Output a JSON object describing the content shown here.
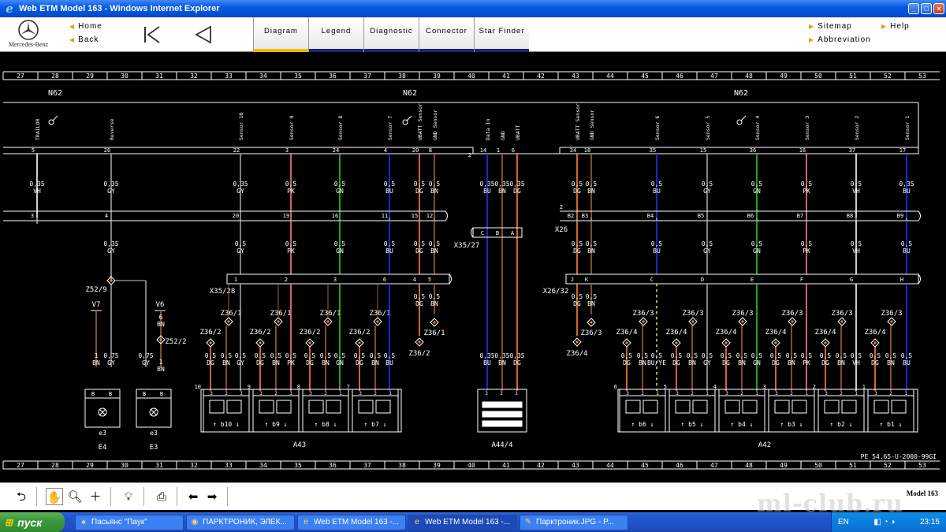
{
  "window": {
    "title": "Web ETM Model 163 - Windows Internet Explorer",
    "controls": [
      "_",
      "□",
      "×"
    ]
  },
  "header": {
    "brand": "Mercedes-Benz",
    "nav_left": [
      {
        "label": "Home"
      },
      {
        "label": "Back"
      }
    ],
    "tabs": [
      {
        "label": "Diagram",
        "active": true
      },
      {
        "label": "Legend"
      },
      {
        "label": "Diagnostic"
      },
      {
        "label": "Connector"
      },
      {
        "label": "Star Finder"
      }
    ],
    "nav_right": [
      {
        "label": "Sitemap"
      },
      {
        "label": "Help"
      },
      {
        "label": "Abbreviation"
      }
    ],
    "icons": [
      "first-page-icon",
      "previous-page-icon"
    ]
  },
  "diagram": {
    "grid_numbers": [
      "27",
      "28",
      "29",
      "30",
      "31",
      "32",
      "33",
      "34",
      "35",
      "36",
      "37",
      "38",
      "39",
      "40",
      "41",
      "42",
      "43",
      "44",
      "45",
      "46",
      "47",
      "48",
      "49",
      "50",
      "51",
      "52",
      "53"
    ],
    "module_labels": [
      "N62",
      "N62",
      "N62"
    ],
    "doc_ref": "PE 54.65-U-2000-99GI",
    "colors": {
      "GY": "#a0a0a0",
      "VH": "#ffffff",
      "PK": "#ff7a8a",
      "GN": "#2ec82e",
      "BU": "#2030ff",
      "BN": "#a06030",
      "DG": "#ff8040"
    },
    "top_pins": [
      {
        "label": "TRAILOR",
        "pin": "5",
        "wire": [
          "0,35",
          "VH"
        ],
        "col": "VH"
      },
      {
        "label": "Reverse",
        "pin": "26",
        "wire": [
          "0,35",
          "GY"
        ],
        "col": "GY"
      },
      {
        "label": "Sensor 10",
        "pin": "22",
        "wire": [
          "0,35",
          "GY"
        ],
        "col": "GY"
      },
      {
        "label": "Sensor 9",
        "pin": "3",
        "wire": [
          "0,5",
          "PK"
        ],
        "col": "PK"
      },
      {
        "label": "Sensor 8",
        "pin": "24",
        "wire": [
          "0,5",
          "GN"
        ],
        "col": "GN"
      },
      {
        "label": "Sensor 7",
        "pin": "4",
        "wire": [
          "0,5",
          "BU"
        ],
        "col": "BU"
      },
      {
        "label": "UBATT Sensor",
        "pin": "20",
        "wire": [
          "0,5",
          "DG"
        ],
        "col": "DG"
      },
      {
        "label": "GND Sensor",
        "pin": "8",
        "wire": [
          "0,5",
          "BN"
        ],
        "col": "BN"
      },
      {
        "label": "Data In",
        "pin": "14",
        "wire": [
          "0,35",
          "BU"
        ],
        "col": "BU"
      },
      {
        "label": "GND",
        "pin": "1",
        "wire": [
          "0,35",
          "BN"
        ],
        "col": "BN"
      },
      {
        "label": "UBATT",
        "pin": "6",
        "wire": [
          "0,35",
          "DG"
        ],
        "col": "DG"
      },
      {
        "label": "UBATT Sensor",
        "pin": "34",
        "wire": [
          "0,5",
          "DG"
        ],
        "col": "DG"
      },
      {
        "label": "GND Sensor",
        "pin": "18",
        "wire": [
          "0,5",
          "BN"
        ],
        "col": "BN"
      },
      {
        "label": "Sensor 6",
        "pin": "35",
        "wire": [
          "0,5",
          "BU"
        ],
        "col": "BU"
      },
      {
        "label": "Sensor 5",
        "pin": "15",
        "wire": [
          "0,5",
          "GY"
        ],
        "col": "GY"
      },
      {
        "label": "Sensor 4",
        "pin": "36",
        "wire": [
          "0,5",
          "GN"
        ],
        "col": "GN"
      },
      {
        "label": "Sensor 3",
        "pin": "16",
        "wire": [
          "0,5",
          "PK"
        ],
        "col": "PK"
      },
      {
        "label": "Sensor 2",
        "pin": "37",
        "wire": [
          "0,5",
          "VH"
        ],
        "col": "VH"
      },
      {
        "label": "Sensor 1",
        "pin": "17",
        "wire": [
          "0,35",
          "BU"
        ],
        "col": "BU"
      }
    ],
    "x26_pins": [
      "3",
      "4",
      "20",
      "19",
      "16",
      "11",
      "15",
      "12",
      "2",
      "B2",
      "B3",
      "B4",
      "B5",
      "B6",
      "B7",
      "B8",
      "B9"
    ],
    "mid_wires": [
      [
        "0,35",
        "GY"
      ],
      [
        "0,5",
        "GY"
      ],
      [
        "0,5",
        "PK"
      ],
      [
        "0,5",
        "GN"
      ],
      [
        "0,5",
        "BU"
      ],
      [
        "0,5",
        "DG"
      ],
      [
        "0,5",
        "BN"
      ],
      [
        "0,5",
        "DG"
      ],
      [
        "0,5",
        "BN"
      ],
      [
        "0,5",
        "BU"
      ],
      [
        "0,5",
        "GY"
      ],
      [
        "0,5",
        "GN"
      ],
      [
        "0,5",
        "PK"
      ],
      [
        "0,5",
        "VH"
      ],
      [
        "0,5",
        "BU"
      ]
    ],
    "connectors": {
      "x35_27": {
        "label": "X35/27",
        "pins": [
          "C",
          "B",
          "A"
        ]
      },
      "x35_28": {
        "label": "X35/28",
        "pins": [
          "1",
          "2",
          "3",
          "6",
          "4",
          "5"
        ]
      },
      "x26_32": {
        "label": "X26/32",
        "pins": [
          "J",
          "K",
          "C",
          "D",
          "E",
          "F",
          "G",
          "H"
        ]
      },
      "x26": {
        "label": "X26"
      }
    },
    "splices": [
      "Z52/9",
      "Z52/2",
      "Z36/1",
      "Z36/2",
      "Z36/3",
      "Z36/4"
    ],
    "side_labels": {
      "v7": "V7",
      "v6": "V6",
      "v7_wire": [
        "1",
        "BN"
      ],
      "v6_wire": [
        "6",
        "BN"
      ],
      "z52_2_wire": [
        "1",
        "BN"
      ]
    },
    "low_wires_left": [
      [
        "1",
        "BN"
      ],
      [
        "0,75",
        "GY"
      ],
      [
        "0,75",
        "GY"
      ],
      [
        "0,5",
        "DG"
      ],
      [
        "0,5",
        "BN"
      ],
      [
        "0,5",
        "GY"
      ],
      [
        "0,5",
        "DG"
      ],
      [
        "0,5",
        "BN"
      ],
      [
        "0,5",
        "PK"
      ],
      [
        "0,5",
        "DG"
      ],
      [
        "0,5",
        "BN"
      ],
      [
        "0,5",
        "GN"
      ],
      [
        "0,5",
        "DG"
      ],
      [
        "0,5",
        "BN"
      ],
      [
        "0,5",
        "BU"
      ]
    ],
    "low_wires_right": [
      [
        "0,5",
        "DG"
      ],
      [
        "0,5",
        "BN"
      ],
      [
        "0,5",
        "BU/YE"
      ],
      [
        "0,5",
        "DG"
      ],
      [
        "0,5",
        "BN"
      ],
      [
        "0,5",
        "GY"
      ],
      [
        "0,5",
        "DG"
      ],
      [
        "0,5",
        "BN"
      ],
      [
        "0,5",
        "GN"
      ],
      [
        "0,5",
        "DG"
      ],
      [
        "0,5",
        "BN"
      ],
      [
        "0,5",
        "PK"
      ],
      [
        "0,5",
        "DG"
      ],
      [
        "0,5",
        "BN"
      ],
      [
        "0,5",
        "VH"
      ],
      [
        "0,5",
        "DG"
      ],
      [
        "0,5",
        "BN"
      ],
      [
        "0,5",
        "BU"
      ]
    ],
    "center_low_wires": [
      [
        "0,35",
        "BU"
      ],
      [
        "0,35",
        "BN"
      ],
      [
        "0,35",
        "DG"
      ]
    ],
    "lamps": [
      {
        "name": "E4",
        "tag": "e3",
        "pins": [
          "B",
          "B"
        ]
      },
      {
        "name": "E3",
        "tag": "e3",
        "pins": [
          "B",
          "B"
        ]
      }
    ],
    "a43_modules": [
      {
        "num": "10",
        "label": "b10"
      },
      {
        "num": "9",
        "label": "b9"
      },
      {
        "num": "8",
        "label": "b8"
      },
      {
        "num": "7",
        "label": "b7"
      }
    ],
    "a42_modules": [
      {
        "num": "6",
        "label": "b6"
      },
      {
        "num": "5",
        "label": "b5"
      },
      {
        "num": "4",
        "label": "b4"
      },
      {
        "num": "3",
        "label": "b3"
      },
      {
        "num": "2",
        "label": "b2"
      },
      {
        "num": "1",
        "label": "b1"
      }
    ],
    "groups": [
      "E4",
      "E3",
      "A43",
      "A44/4",
      "A42"
    ]
  },
  "toolbar": {
    "model": "Model 163",
    "watermark": "ml-club.ru"
  },
  "taskbar": {
    "start": "пуск",
    "tasks": [
      {
        "label": "Пасьянс \"Паук\"",
        "icon": "solitaire-icon"
      },
      {
        "label": "ПАРКТРОНИК, ЭЛЕК...",
        "icon": "chrome-icon"
      },
      {
        "label": "Web ETM Model 163 -...",
        "icon": "ie-icon"
      },
      {
        "label": "Web ETM Model 163 -...",
        "icon": "ie-icon",
        "active": true
      },
      {
        "label": "Парктроник.JPG - P...",
        "icon": "paint-icon"
      }
    ],
    "lang": "EN",
    "time": "23:15"
  }
}
